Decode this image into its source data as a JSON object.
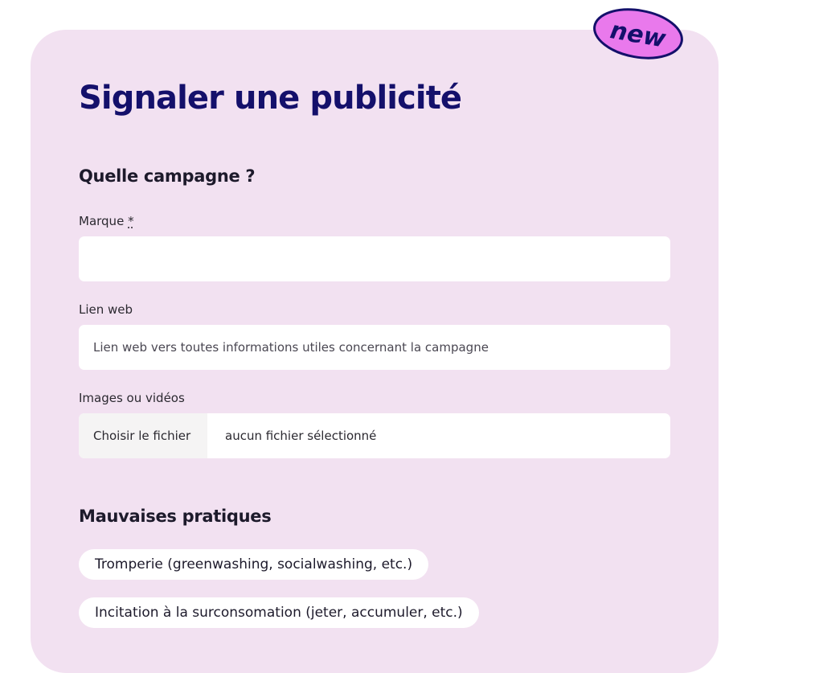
{
  "badge": {
    "label": "new",
    "fill": "#e979ec",
    "text_color": "#14106b"
  },
  "colors": {
    "card_background": "#f2e1f1",
    "title": "#14106b",
    "text": "#1d1a2b"
  },
  "form": {
    "title": "Signaler une publicité",
    "campaign_section": {
      "title": "Quelle campagne ?",
      "brand": {
        "label": "Marque",
        "required_marker": "*",
        "value": "",
        "placeholder": ""
      },
      "link": {
        "label": "Lien web",
        "value": "",
        "placeholder": "Lien web vers toutes informations utiles concernant la campagne"
      },
      "media": {
        "label": "Images ou vidéos",
        "button_label": "Choisir le fichier",
        "status": "aucun fichier sélectionné"
      }
    },
    "practices_section": {
      "title": "Mauvaises pratiques",
      "options": [
        "Tromperie (greenwashing, socialwashing, etc.)",
        "Incitation à la surconsomation (jeter, accumuler, etc.)"
      ]
    }
  }
}
